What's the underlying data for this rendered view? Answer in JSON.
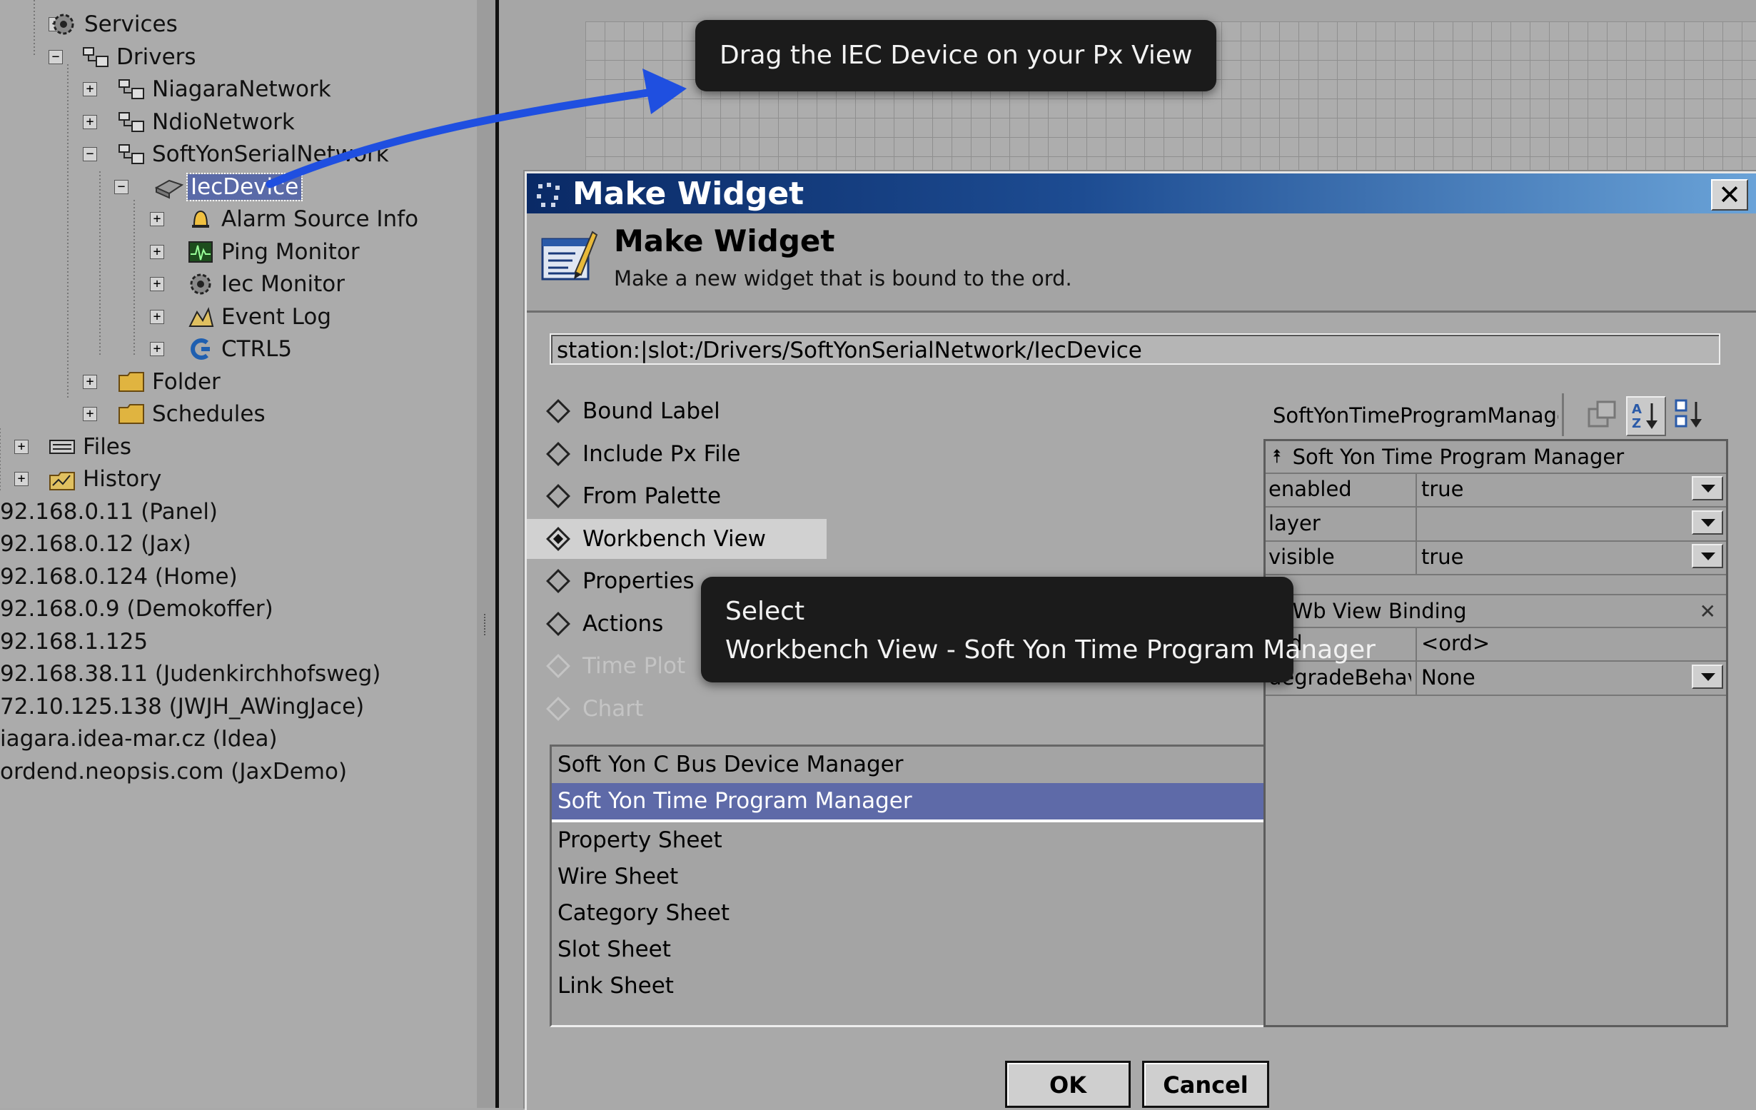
{
  "tree": {
    "items": [
      {
        "label": "Services",
        "icon": "gear-icon",
        "expander": "+"
      },
      {
        "label": "Drivers",
        "icon": "network-icon",
        "expander": "−"
      },
      {
        "label": "NiagaraNetwork",
        "icon": "network-icon",
        "expander": "+"
      },
      {
        "label": "NdioNetwork",
        "icon": "network-icon",
        "expander": "+"
      },
      {
        "label": "SoftYonSerialNetwork",
        "icon": "network-icon",
        "expander": "−"
      },
      {
        "label": "IecDevice",
        "icon": "device-icon",
        "expander": "−",
        "selected": true
      },
      {
        "label": "Alarm Source Info",
        "icon": "bell-icon",
        "expander": "+"
      },
      {
        "label": "Ping Monitor",
        "icon": "monitor-icon",
        "expander": "+"
      },
      {
        "label": "Iec Monitor",
        "icon": "gear-icon",
        "expander": "+"
      },
      {
        "label": "Event Log",
        "icon": "event-log-icon",
        "expander": "+"
      },
      {
        "label": "CTRL5",
        "icon": "ctrl-icon",
        "expander": "+"
      },
      {
        "label": "Folder",
        "icon": "folder-icon",
        "expander": "+"
      },
      {
        "label": "Schedules",
        "icon": "folder-icon",
        "expander": "+"
      },
      {
        "label": "Files",
        "icon": "files-icon",
        "expander": "+"
      },
      {
        "label": "History",
        "icon": "history-icon",
        "expander": "+"
      },
      {
        "label": "92.168.0.11 (Panel)"
      },
      {
        "label": "92.168.0.12 (Jax)"
      },
      {
        "label": "92.168.0.124 (Home)"
      },
      {
        "label": "92.168.0.9 (Demokoffer)"
      },
      {
        "label": "92.168.1.125"
      },
      {
        "label": "92.168.38.11 (Judenkirchhofsweg)"
      },
      {
        "label": "72.10.125.138 (JWJH_AWingJace)"
      },
      {
        "label": "iagara.idea-mar.cz (Idea)"
      },
      {
        "label": "ordend.neopsis.com (JaxDemo)"
      }
    ]
  },
  "tooltips": {
    "drag": "Drag the IEC Device on your Px View",
    "select_line1": "Select",
    "select_line2": "Workbench View - Soft Yon Time Program Manager"
  },
  "dialog": {
    "window_title": "Make Widget",
    "close_glyph": "✕",
    "header_title": "Make Widget",
    "header_subtitle": "Make a new widget that is bound to the ord.",
    "ord": "station:|slot:/Drivers/SoftYonSerialNetwork/IecDevice",
    "options": [
      {
        "label": "Bound Label",
        "state": "normal"
      },
      {
        "label": "Include Px File",
        "state": "normal"
      },
      {
        "label": "From Palette",
        "state": "normal"
      },
      {
        "label": "Workbench View",
        "state": "selected"
      },
      {
        "label": "Properties",
        "state": "normal"
      },
      {
        "label": "Actions",
        "state": "normal"
      },
      {
        "label": "Time Plot",
        "state": "disabled"
      },
      {
        "label": "Chart",
        "state": "disabled"
      }
    ],
    "views": [
      {
        "label": "Soft Yon C Bus Device Manager"
      },
      {
        "label": "Soft Yon Time Program Manager",
        "selected": true
      },
      {
        "label": "Property Sheet"
      },
      {
        "label": "Wire Sheet"
      },
      {
        "label": "Category Sheet"
      },
      {
        "label": "Slot Sheet"
      },
      {
        "label": "Link Sheet"
      }
    ],
    "property_sheet": {
      "title": "SoftYonTimeProgramManage",
      "group1": {
        "label": "Soft Yon Time Program Manager",
        "rows": [
          {
            "name": "enabled",
            "value": "true"
          },
          {
            "name": "layer",
            "value": ""
          },
          {
            "name": "visible",
            "value": "true"
          }
        ]
      },
      "group2": {
        "label": "Wb View Binding",
        "close_glyph": "✕",
        "rows": [
          {
            "name": "ord",
            "value": "<ord>"
          },
          {
            "name": "degradeBehavi",
            "value": "None"
          }
        ]
      }
    },
    "ok_label": "OK",
    "cancel_label": "Cancel"
  },
  "colors": {
    "selection": "#5e6aa8",
    "tooltip_bg": "#1b1b1b",
    "arrow": "#1f4fe0",
    "title_start": "#0a2a66",
    "title_end": "#6aa3d8"
  }
}
